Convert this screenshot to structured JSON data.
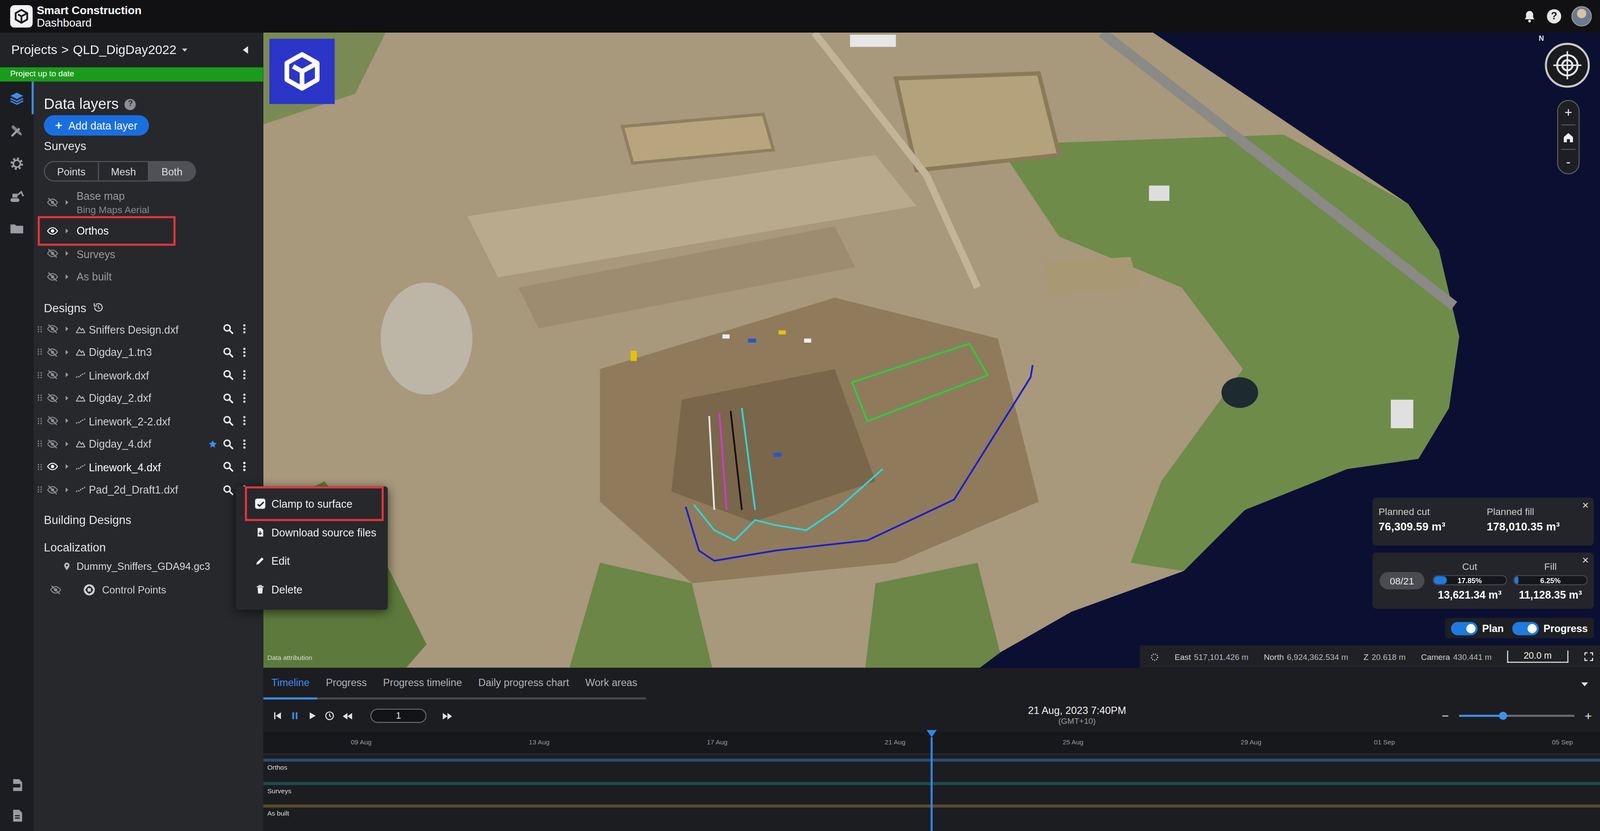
{
  "header": {
    "brand_line1": "Smart Construction",
    "brand_line2": "Dashboard",
    "help": "?"
  },
  "breadcrumb": {
    "root": "Projects",
    "separator": ">",
    "project": "QLD_DigDay2022"
  },
  "status_banner": "Project up to date",
  "rail": {
    "top": [
      {
        "kind": "layers",
        "selected": true
      },
      {
        "kind": "tools",
        "selected": false
      },
      {
        "kind": "settings",
        "selected": false
      },
      {
        "kind": "machines",
        "selected": false
      },
      {
        "kind": "files",
        "selected": false
      }
    ],
    "bottom": [
      {
        "kind": "pdf",
        "selected": false
      },
      {
        "kind": "report",
        "selected": false
      }
    ]
  },
  "data_layers": {
    "title": "Data layers",
    "help": "?",
    "add_icon": "+",
    "add_button": "Add data layer"
  },
  "surveys": {
    "title": "Surveys",
    "modes": [
      {
        "label": "Points",
        "selected": false
      },
      {
        "label": "Mesh",
        "selected": false
      },
      {
        "label": "Both",
        "selected": true
      }
    ],
    "layers": [
      {
        "name": "Base map",
        "subtitle": "Bing Maps Aerial",
        "visible": false,
        "highlighted": false
      },
      {
        "name": "Orthos",
        "visible": true,
        "highlighted": true
      },
      {
        "name": "Surveys",
        "visible": false,
        "highlighted": false
      },
      {
        "name": "As built",
        "visible": false,
        "highlighted": false
      }
    ]
  },
  "designs": {
    "title": "Designs",
    "items": [
      {
        "name": "Sniffers Design.dxf",
        "kind": "surface",
        "visible": false,
        "starred": false,
        "menu_open": false
      },
      {
        "name": "Digday_1.tn3",
        "kind": "surface",
        "visible": false,
        "starred": false,
        "menu_open": false
      },
      {
        "name": "Linework.dxf",
        "kind": "linework",
        "visible": false,
        "starred": false,
        "menu_open": false
      },
      {
        "name": "Digday_2.dxf",
        "kind": "surface",
        "visible": false,
        "starred": false,
        "menu_open": false
      },
      {
        "name": "Linework_2-2.dxf",
        "kind": "linework",
        "visible": false,
        "starred": false,
        "menu_open": false
      },
      {
        "name": "Digday_4.dxf",
        "kind": "surface",
        "visible": false,
        "starred": true,
        "menu_open": false
      },
      {
        "name": "Linework_4.dxf",
        "kind": "linework",
        "visible": true,
        "starred": false,
        "menu_open": true
      },
      {
        "name": "Pad_2d_Draft1.dxf",
        "kind": "linework",
        "visible": false,
        "starred": false,
        "menu_open": false
      }
    ]
  },
  "context_menu": {
    "items": [
      {
        "label": "Clamp to surface",
        "kind": "checkbox",
        "checked": true,
        "highlighted": true
      },
      {
        "label": "Download source files",
        "kind": "download",
        "highlighted": false
      },
      {
        "label": "Edit",
        "kind": "edit",
        "highlighted": false
      },
      {
        "label": "Delete",
        "kind": "delete",
        "highlighted": false
      }
    ]
  },
  "building_designs": {
    "title": "Building Designs"
  },
  "localization": {
    "title": "Localization",
    "file": "Dummy_Sniffers_GDA94.gc3",
    "control_points": {
      "label": "Control Points",
      "visible": false
    }
  },
  "map": {
    "compass": "N",
    "zoom_in": "+",
    "zoom_out": "-",
    "attribution": "Data attribution",
    "linework": [
      {
        "color": "#2ecc40"
      },
      {
        "color": "#1c1cd0"
      },
      {
        "color": "#2fd6d6"
      },
      {
        "color": "#e8e8e8"
      },
      {
        "color": "#d23ad2"
      },
      {
        "color": "#111111"
      },
      {
        "color": "#2fd6d6"
      }
    ],
    "coordinates": [
      {
        "label": "East",
        "value": "517,101.426 m"
      },
      {
        "label": "North",
        "value": "6,924,362.534 m"
      },
      {
        "label": "Z",
        "value": "20.618 m"
      },
      {
        "label": "Camera",
        "value": "430.441 m"
      }
    ],
    "scale": "20.0 m"
  },
  "planned": {
    "close": "×",
    "items": [
      {
        "label": "Planned cut",
        "value": "76,309.59 m³"
      },
      {
        "label": "Planned fill",
        "value": "178,010.35 m³"
      }
    ]
  },
  "progress": {
    "close": "×",
    "date": "08/21",
    "items": [
      {
        "label": "Cut",
        "percent": "17.85%",
        "level": 0.1785,
        "value": "13,621.34 m³"
      },
      {
        "label": "Fill",
        "percent": "6.25%",
        "level": 0.0625,
        "value": "11,128.35 m³"
      }
    ]
  },
  "toggles": [
    {
      "label": "Plan",
      "on": true
    },
    {
      "label": "Progress",
      "on": true
    }
  ],
  "bottom_tabs": [
    {
      "label": "Timeline",
      "selected": true
    },
    {
      "label": "Progress",
      "selected": false
    },
    {
      "label": "Progress timeline",
      "selected": false
    },
    {
      "label": "Daily progress chart",
      "selected": false
    },
    {
      "label": "Work areas",
      "selected": false
    }
  ],
  "timeline": {
    "playing": true,
    "speed": "1",
    "date": "21 Aug, 2023 7:40PM",
    "timezone": "(GMT+10)",
    "zoom_out": "−",
    "zoom_in": "+",
    "zoom_level": 0.38,
    "playhead": 0.5,
    "ticks": [
      "09 Aug",
      "13 Aug",
      "17 Aug",
      "21 Aug",
      "25 Aug",
      "29 Aug",
      "01 Sep",
      "05 Sep"
    ],
    "tracks": [
      {
        "label": "Orthos",
        "color": "#2c4a72"
      },
      {
        "label": "Surveys",
        "color": "#1e4b49"
      },
      {
        "label": "As built",
        "color": "#5b4b2c"
      }
    ]
  }
}
